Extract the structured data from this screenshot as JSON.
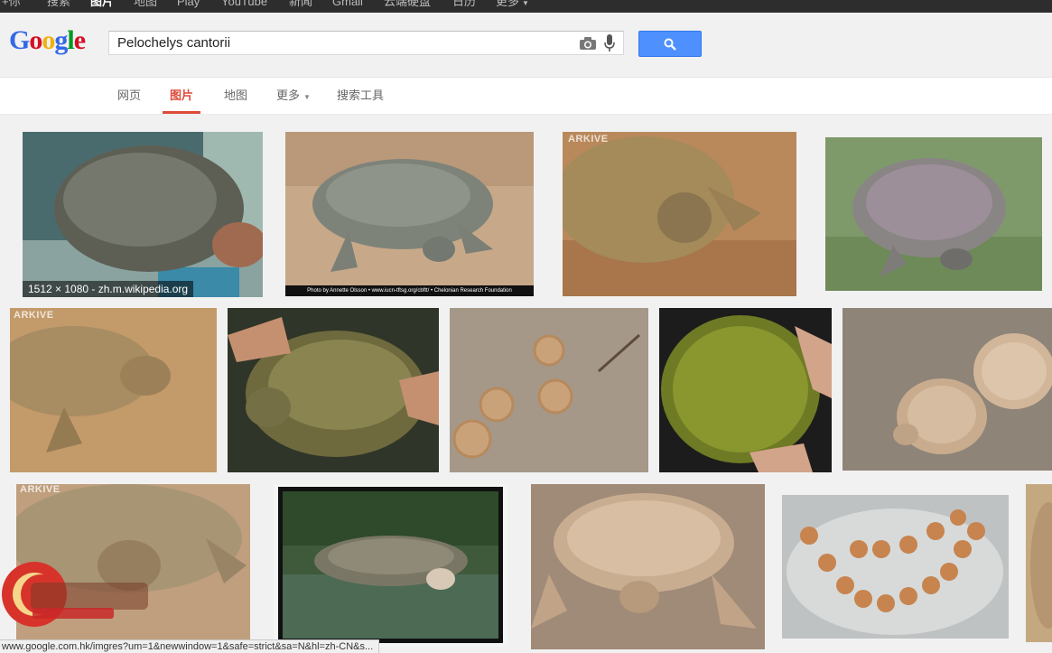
{
  "topbar": {
    "items": [
      {
        "label": "+你"
      },
      {
        "label": "搜索"
      },
      {
        "label": "图片"
      },
      {
        "label": "地图"
      },
      {
        "label": "Play"
      },
      {
        "label": "YouTube"
      },
      {
        "label": "新闻"
      },
      {
        "label": "Gmail"
      },
      {
        "label": "云端硬盘"
      },
      {
        "label": "日历"
      },
      {
        "label": "更多"
      }
    ]
  },
  "logo": {
    "letters": [
      "G",
      "o",
      "o",
      "g",
      "l",
      "e"
    ]
  },
  "search": {
    "value": "Pelochelys cantorii"
  },
  "tabs": [
    {
      "label": "网页"
    },
    {
      "label": "图片"
    },
    {
      "label": "地图"
    },
    {
      "label": "更多"
    },
    {
      "label": "搜索工具"
    }
  ],
  "results": {
    "hover_info": "1512 × 1080 - zh.m.wikipedia.org",
    "credit_text": "Photo by Annette Olsson  •  www.iucn-tftsg.org/cbftt/  •  Chelonian Research Foundation",
    "arkive_mark": "ARKIVE"
  },
  "status": {
    "url": "www.google.com.hk/imgres?um=1&newwindow=1&safe=strict&sa=N&hl=zh-CN&s..."
  },
  "colors": {
    "accent_red": "#dd4b39",
    "search_blue": "#4d90fe",
    "topbar_bg": "#2d2d2d"
  }
}
